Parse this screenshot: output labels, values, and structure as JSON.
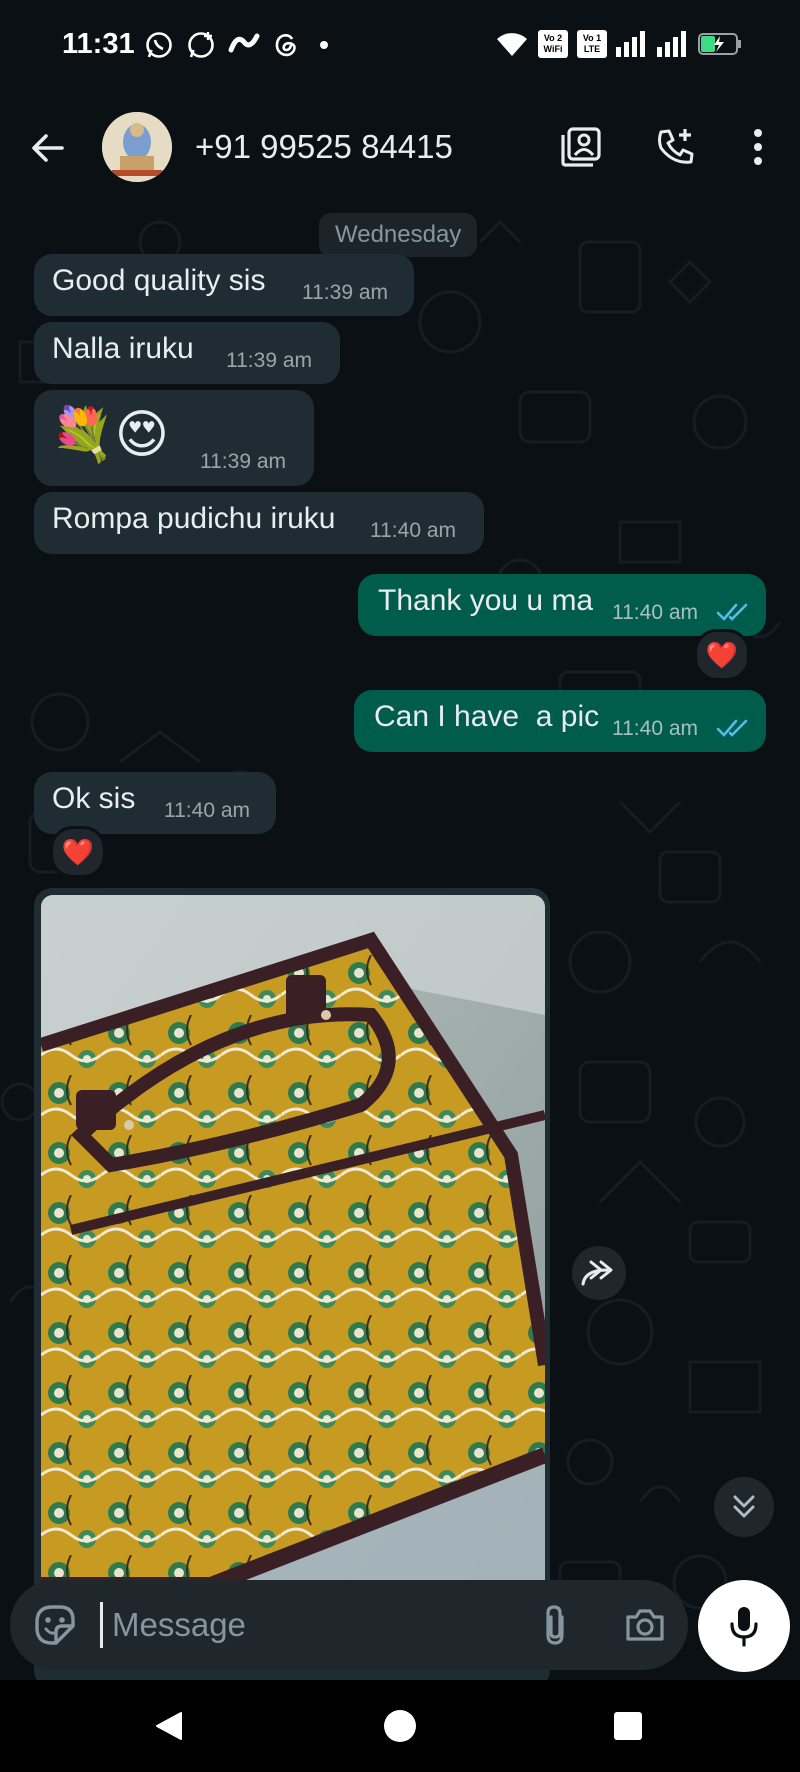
{
  "status_bar": {
    "time": "11:31",
    "sim1_label_top": "Vo",
    "sim1_label_num": "2",
    "sim1_label_sub": "WiFi",
    "sim2_label_top": "Vo",
    "sim2_label_num": "1",
    "sim2_label_sub": "LTE"
  },
  "header": {
    "contact_name": "+91 99525 84415"
  },
  "chat": {
    "date_chip": "Wednesday",
    "messages": [
      {
        "text": "Good quality sis",
        "time": "11:39 am"
      },
      {
        "text": "Nalla iruku",
        "time": "11:39 am"
      },
      {
        "text": "💐😍",
        "time": "11:39 am"
      },
      {
        "text": "Rompa pudichu iruku",
        "time": "11:40 am"
      },
      {
        "text": "Thank you u ma",
        "time": "11:40 am"
      },
      {
        "text": "Can I have  a pic",
        "time": "11:40 am"
      },
      {
        "text": "Ok sis",
        "time": "11:40 am"
      }
    ],
    "reaction_emoji": "❤️"
  },
  "composer": {
    "placeholder": "Message"
  },
  "colors": {
    "background": "#0b1014",
    "incoming_bubble": "#202c33",
    "outgoing_bubble": "#005c4b",
    "read_ticks": "#53bdeb"
  },
  "icons": {
    "back": "arrow-left-icon",
    "contact_card": "contact-card-icon",
    "add_call": "add-call-icon",
    "menu": "more-vertical-icon",
    "forward": "forward-icon",
    "scroll_down": "double-chevron-down-icon",
    "sticker": "sticker-icon",
    "attach": "paperclip-icon",
    "camera": "camera-icon",
    "mic": "microphone-icon"
  }
}
